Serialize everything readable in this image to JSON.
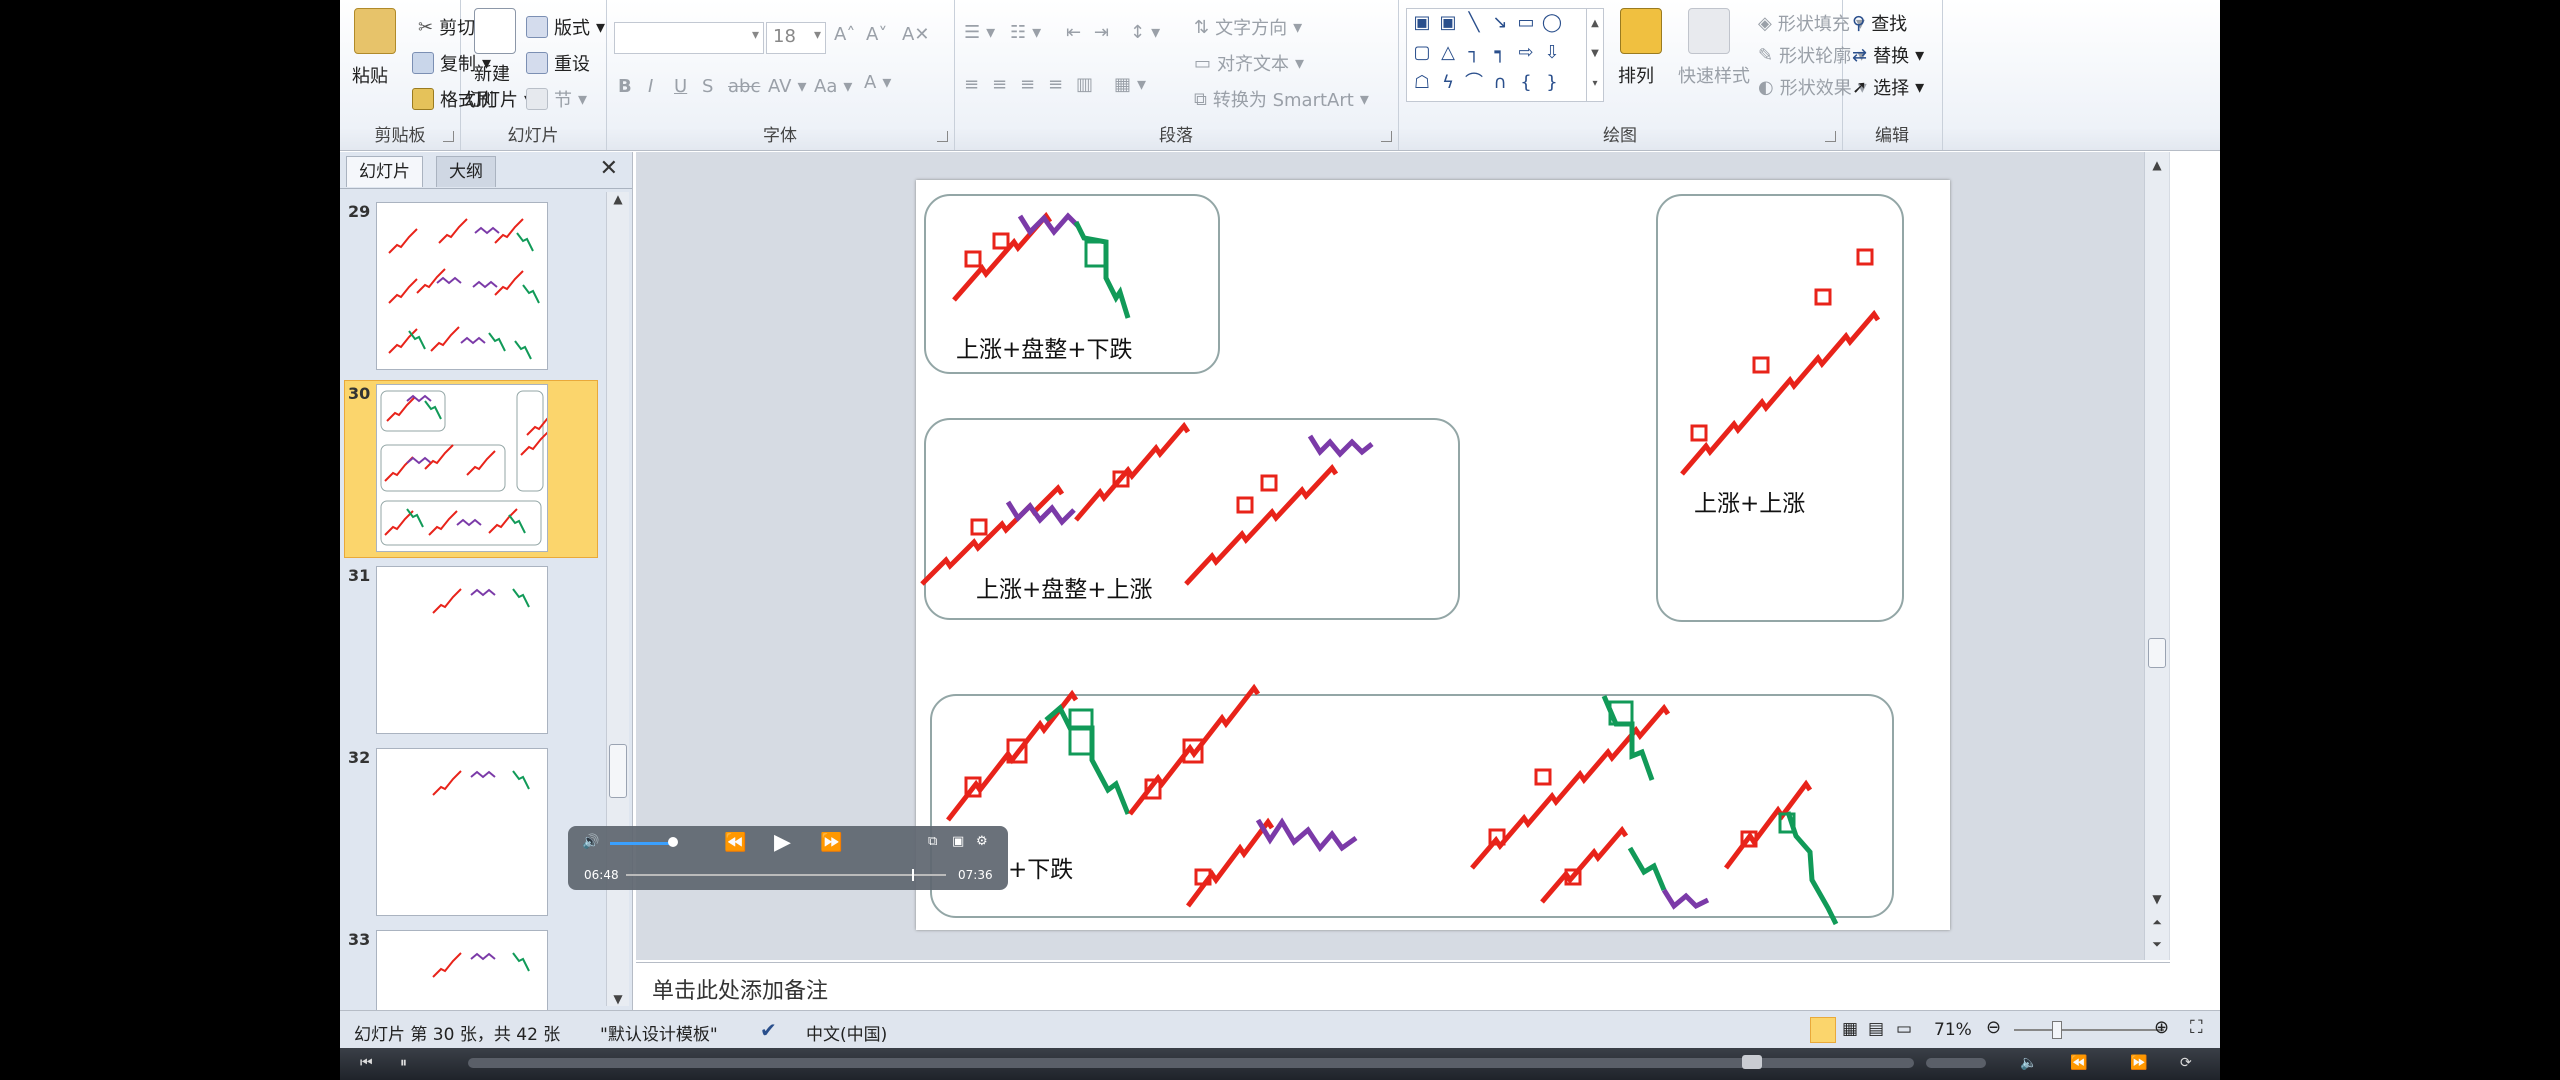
{
  "ribbon": {
    "clipboard": {
      "paste": "粘贴",
      "cut": "剪切",
      "copy": "复制",
      "painter": "格式刷",
      "label": "剪贴板"
    },
    "slides": {
      "new_slide_l1": "新建",
      "new_slide_l2": "幻灯片",
      "layout": "版式",
      "reset": "重设",
      "section": "节",
      "label": "幻灯片"
    },
    "font": {
      "size": "18",
      "label": "字体",
      "b": "B",
      "i": "I",
      "u": "U",
      "s": "S",
      "abc": "abc",
      "av": "AV",
      "aa": "Aa",
      "a": "A"
    },
    "paragraph": {
      "text_direction": "文字方向",
      "align_text": "对齐文本",
      "smartart": "转换为 SmartArt",
      "label": "段落"
    },
    "drawing": {
      "arrange": "排列",
      "quick_styles": "快速样式",
      "fill": "形状填充",
      "outline": "形状轮廓",
      "effects": "形状效果",
      "label": "绘图"
    },
    "editing": {
      "find": "查找",
      "replace": "替换",
      "select": "选择",
      "label": "编辑"
    }
  },
  "left_pane": {
    "tab_slides": "幻灯片",
    "tab_outline": "大纲",
    "thumbs": [
      {
        "num": "29"
      },
      {
        "num": "30"
      },
      {
        "num": "31"
      },
      {
        "num": "32"
      },
      {
        "num": "33"
      }
    ]
  },
  "slide": {
    "captions": {
      "a": "上涨+盘整+下跌",
      "b": "上涨+盘整+上涨",
      "c": "上涨+上涨",
      "d": "+下跌"
    }
  },
  "notes": {
    "placeholder": "单击此处添加备注"
  },
  "status": {
    "slide_info": "幻灯片 第 30 张，共 42 张",
    "theme": "\"默认设计模板\"",
    "language": "中文(中国)",
    "zoom": "71%"
  },
  "player": {
    "current_time": "06:48",
    "total_time": "07:36"
  },
  "colors": {
    "up": "#e8231a",
    "flat": "#7b3aa8",
    "down": "#119a58",
    "selected": "#fbd56c"
  }
}
